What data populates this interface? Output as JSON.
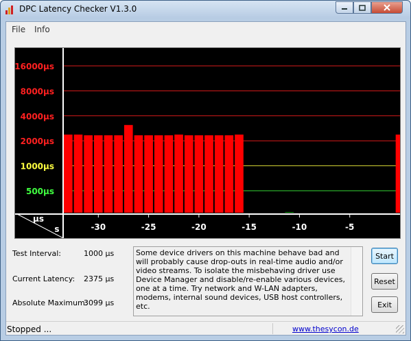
{
  "window": {
    "title": "DPC Latency Checker V1.3.0",
    "icon": "dpc-app-icon",
    "controls": {
      "minimize_icon": "minimize-icon",
      "maximize_icon": "maximize-icon",
      "close_icon": "close-icon"
    }
  },
  "menu": {
    "items": [
      "File",
      "Info"
    ]
  },
  "chart_data": {
    "type": "bar",
    "title": "",
    "xlabel": "s",
    "ylabel": "µs",
    "xlim": [
      -33.5,
      0
    ],
    "x_ticks": [
      -30,
      -25,
      -20,
      -15,
      -10,
      -5
    ],
    "y_scale": "log",
    "y_ticks": [
      {
        "label": "16000µs",
        "value": 16000,
        "color": "#ff2020"
      },
      {
        "label": "8000µs",
        "value": 8000,
        "color": "#ff2020"
      },
      {
        "label": "4000µs",
        "value": 4000,
        "color": "#ff2020"
      },
      {
        "label": "2000µs",
        "value": 2000,
        "color": "#ff2020"
      },
      {
        "label": "1000µs",
        "value": 1000,
        "color": "#ffff40"
      },
      {
        "label": "500µs",
        "value": 500,
        "color": "#40ff40"
      }
    ],
    "grid": true,
    "background": "#000000",
    "bar_colors": {
      "high": "#ff0000",
      "ok": "#00ff00"
    },
    "x": [
      -33,
      -32,
      -31,
      -30,
      -29,
      -28,
      -27,
      -26,
      -25,
      -24,
      -23,
      -22,
      -21,
      -20,
      -19,
      -18,
      -17,
      -16,
      -15,
      -14,
      -13,
      -12,
      -11,
      -10,
      -9,
      -8,
      -7,
      -6,
      -5,
      -4,
      -3,
      -2,
      -1,
      0
    ],
    "values": [
      2375,
      2375,
      2330,
      2330,
      2330,
      2330,
      3099,
      2330,
      2330,
      2330,
      2330,
      2375,
      2330,
      2330,
      2330,
      2330,
      2330,
      2375,
      210,
      240,
      240,
      210,
      275,
      255,
      240,
      230,
      240,
      240,
      230,
      240,
      230,
      240,
      240,
      2375
    ],
    "status": [
      "high",
      "high",
      "high",
      "high",
      "high",
      "high",
      "high",
      "high",
      "high",
      "high",
      "high",
      "high",
      "high",
      "high",
      "high",
      "high",
      "high",
      "high",
      "ok",
      "ok",
      "ok",
      "ok",
      "ok",
      "ok",
      "ok",
      "ok",
      "ok",
      "ok",
      "ok",
      "ok",
      "ok",
      "ok",
      "ok",
      "high"
    ]
  },
  "stats": {
    "test_interval": {
      "label": "Test Interval:",
      "value": "1000 µs"
    },
    "current_latency": {
      "label": "Current Latency:",
      "value": "2375 µs"
    },
    "absolute_maximum": {
      "label": "Absolute Maximum:",
      "value": "3099 µs"
    }
  },
  "message": "Some device drivers on this machine behave bad and will probably cause drop-outs in real-time audio and/or video streams. To isolate the misbehaving driver use Device Manager and disable/re-enable various devices, one at a time. Try network and W-LAN adapters, modems, internal sound devices, USB host controllers, etc.",
  "buttons": {
    "start": "Start",
    "reset": "Reset",
    "exit": "Exit"
  },
  "status": {
    "text": "Stopped ...",
    "link": "www.thesycon.de"
  }
}
